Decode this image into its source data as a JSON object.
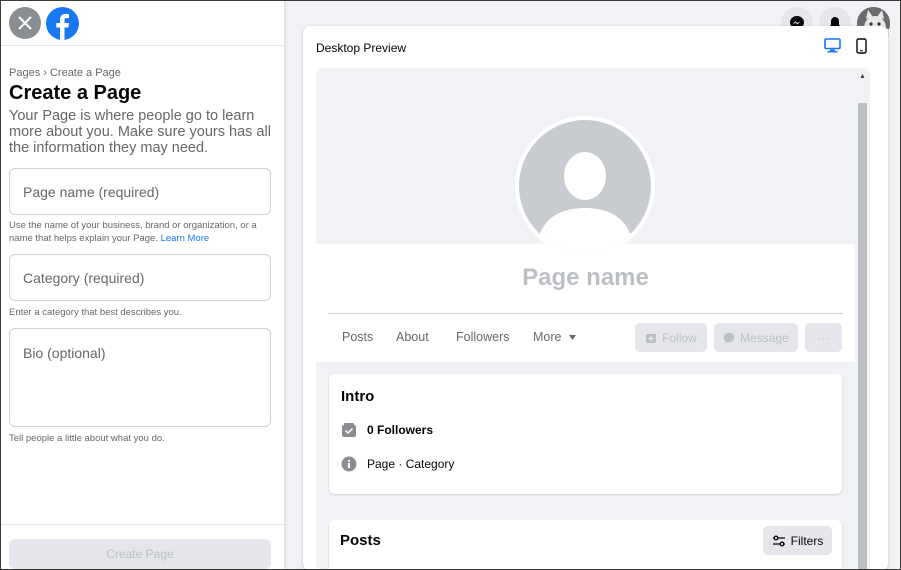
{
  "left_panel": {
    "breadcrumb": "Pages › Create a Page",
    "title": "Create a Page",
    "description": "Your Page is where people go to learn more about you. Make sure yours has all the information they may need.",
    "page_name_placeholder": "Page name (required)",
    "page_name_help": "Use the name of your business, brand or organization, or a name that helps explain your Page.",
    "learn_more": "Learn More",
    "category_placeholder": "Category (required)",
    "category_help": "Enter a category that best describes you.",
    "bio_placeholder": "Bio (optional)",
    "bio_help": "Tell people a little about what you do.",
    "create_button": "Create Page"
  },
  "preview": {
    "title": "Desktop Preview",
    "page_name": "Page name",
    "tabs": [
      "Posts",
      "About",
      "Followers",
      "More"
    ],
    "follow_button": "Follow",
    "message_button": "Message",
    "more_button": "···",
    "intro_title": "Intro",
    "followers_text": "0 Followers",
    "page_category_text": "Page · Category",
    "posts_title": "Posts",
    "filters_button": "Filters"
  },
  "colors": {
    "brand": "#1877f2",
    "background": "#f0f2f5"
  },
  "icons": [
    "close-icon",
    "facebook-logo",
    "messenger-icon",
    "bell-icon",
    "avatar",
    "desktop-icon",
    "mobile-icon",
    "info-icon",
    "followers-icon",
    "filters-icon"
  ]
}
